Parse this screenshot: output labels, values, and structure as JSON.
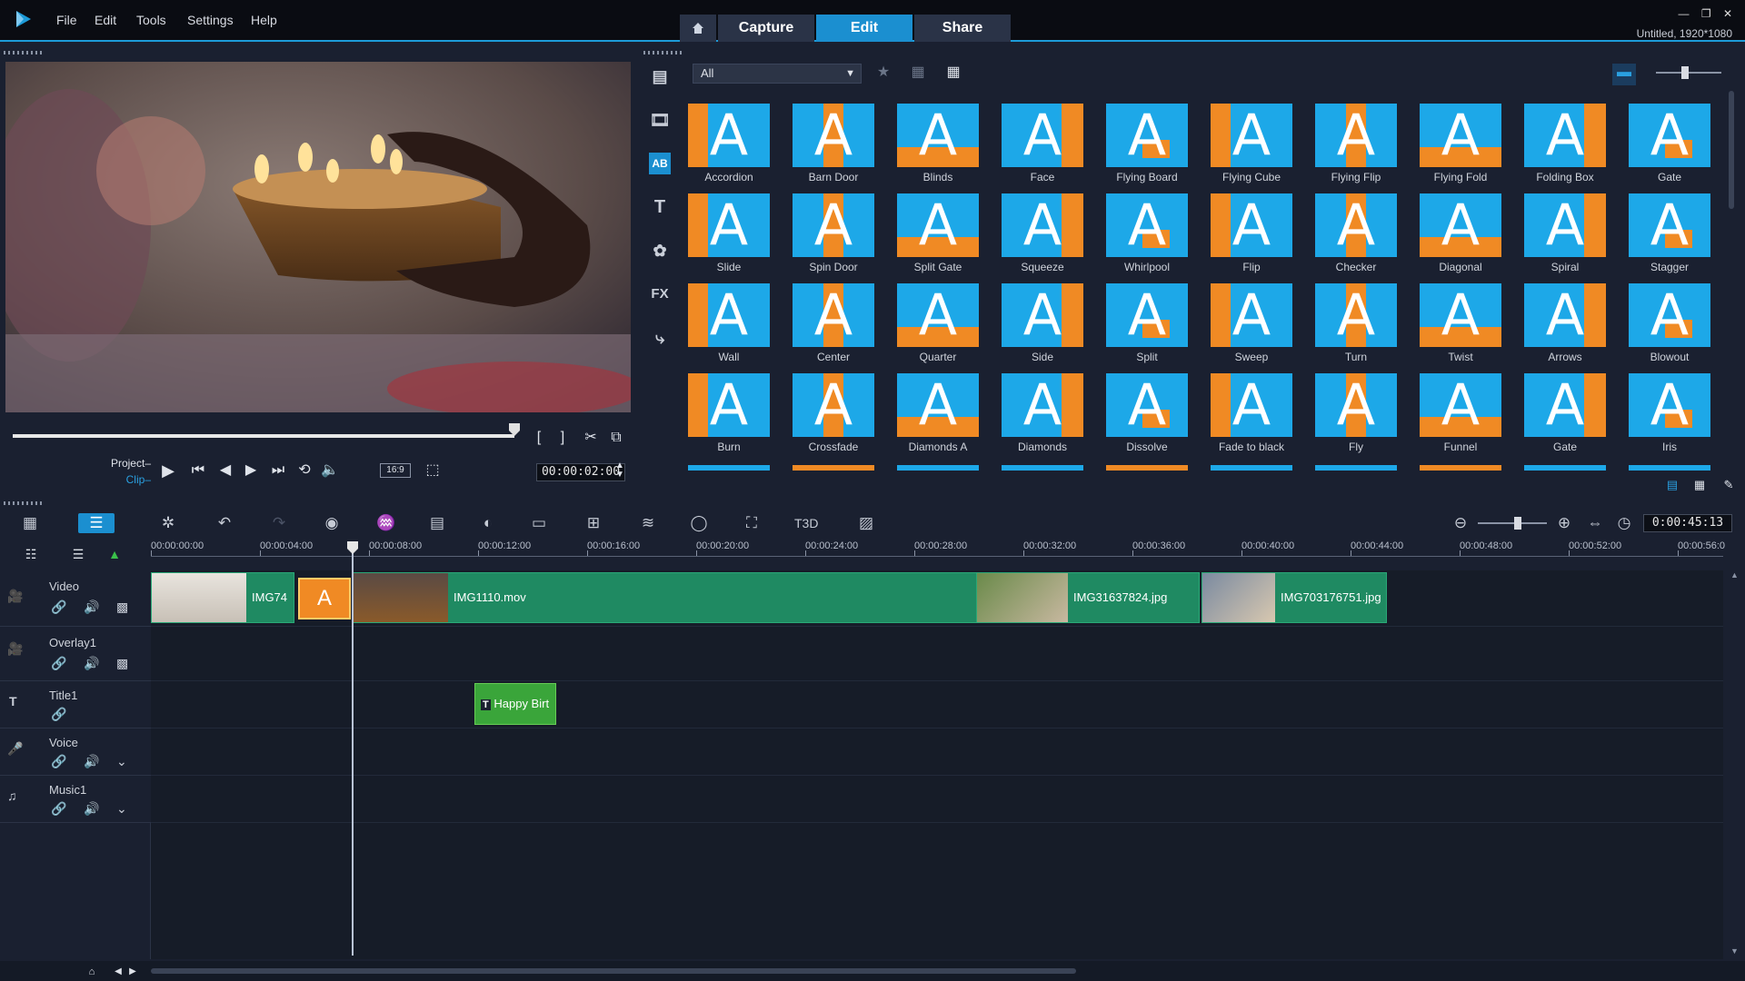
{
  "menu": {
    "file": "File",
    "edit": "Edit",
    "tools": "Tools",
    "settings": "Settings",
    "help": "Help"
  },
  "tabs": {
    "capture": "Capture",
    "edit": "Edit",
    "share": "Share"
  },
  "window": {
    "minimize": "—",
    "restore": "❐",
    "close": "✕",
    "project_info": "Untitled, 1920*1080"
  },
  "player": {
    "project_label": "Project–",
    "clip_label": "Clip–",
    "aspect": "16:9",
    "timecode": "00:00:02:00"
  },
  "library": {
    "filter": "All",
    "side_fx": "FX",
    "transitions": [
      "Accordion",
      "Barn Door",
      "Blinds",
      "Face",
      "Flying Board",
      "Flying Cube",
      "Flying Flip",
      "Flying Fold",
      "Folding Box",
      "Gate",
      "Slide",
      "Spin Door",
      "Split Gate",
      "Squeeze",
      "Whirlpool",
      "Flip",
      "Checker",
      "Diagonal",
      "Spiral",
      "Stagger",
      "Wall",
      "Center",
      "Quarter",
      "Side",
      "Split",
      "Sweep",
      "Turn",
      "Twist",
      "Arrows",
      "Blowout",
      "Burn",
      "Crossfade",
      "Diamonds A",
      "Diamonds",
      "Dissolve",
      "Fade to black",
      "Fly",
      "Funnel",
      "Gate",
      "Iris"
    ]
  },
  "timeline": {
    "duration": "0:00:45:13",
    "ruler": [
      "00:00:00:00",
      "00:00:04:00",
      "00:00:08:00",
      "00:00:12:00",
      "00:00:16:00",
      "00:00:20:00",
      "00:00:24:00",
      "00:00:28:00",
      "00:00:32:00",
      "00:00:36:00",
      "00:00:40:00",
      "00:00:44:00",
      "00:00:48:00",
      "00:00:52:00",
      "00:00:56:0"
    ],
    "tracks": {
      "video": "Video",
      "overlay": "Overlay1",
      "title": "Title1",
      "voice": "Voice",
      "music": "Music1"
    },
    "clips": {
      "c1": "IMG74",
      "c2": "IMG1110.mov",
      "c3": "IMG31637824.jpg",
      "c4": "IMG703176751.jpg",
      "title": "Happy Birt"
    }
  },
  "colors": {
    "accent": "#1b8fd0",
    "clip": "#1f8a62",
    "title_clip": "#3aa53a",
    "transition_bg": "#1da8e8",
    "transition_orange": "#f08a24"
  }
}
